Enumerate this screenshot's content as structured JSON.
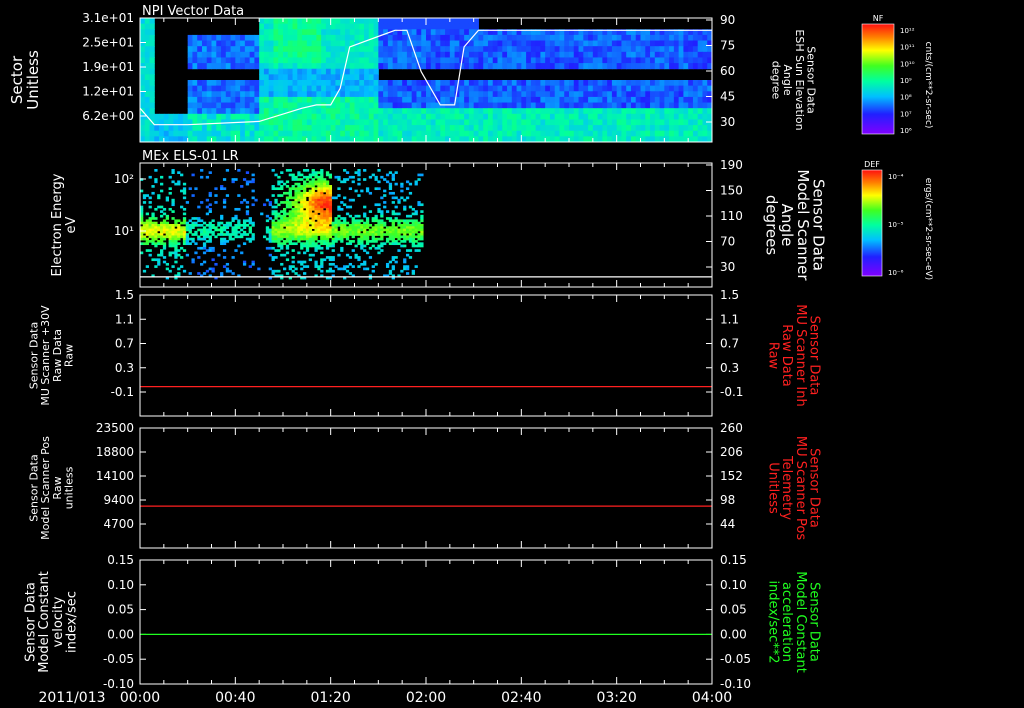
{
  "date_label": "2011/013",
  "x_axis": {
    "ticks": [
      "00:00",
      "00:40",
      "01:20",
      "02:00",
      "02:40",
      "03:20",
      "04:00"
    ],
    "range_minutes": [
      0,
      240
    ]
  },
  "colorbars": [
    {
      "tag": "NF",
      "unit": "cnts/(cm**2-sr-sec)",
      "ticks": [
        "10¹²",
        "10¹¹",
        "10¹⁰",
        "10⁹",
        "10⁸",
        "10⁷",
        "10⁶"
      ]
    },
    {
      "tag": "DEF",
      "unit": "ergs/(cm**2-sr-sec-eV)",
      "ticks": [
        "10⁻⁴",
        "10⁻⁵",
        "10⁻⁶"
      ]
    }
  ],
  "chart_data": [
    {
      "type": "heatmap",
      "title": "NPI Vector Data",
      "ylabel": [
        "Sector",
        "Unitless"
      ],
      "y_ticks": [
        "3.1e+01",
        "2.5e+01",
        "1.9e+01",
        "1.2e+01",
        "6.2e+00"
      ],
      "right_label": [
        "Sensor Data",
        "ESH Sun Elevation",
        "Angle",
        "degree"
      ],
      "right_ticks": [
        "90",
        "75",
        "60",
        "45",
        "30"
      ],
      "y2lim": [
        20,
        90
      ],
      "line": {
        "name": "ESH Sun Elevation",
        "color": "#ffffff",
        "x": [
          0,
          6,
          20,
          50,
          68,
          74,
          80,
          84,
          88,
          107,
          112,
          118,
          126,
          132,
          136,
          142,
          240
        ],
        "y": [
          38,
          28,
          28,
          30,
          38,
          40,
          40,
          50,
          75,
          85,
          85,
          60,
          40,
          40,
          75,
          85,
          85
        ]
      }
    },
    {
      "type": "heatmap",
      "title": "MEx ELS-01 LR",
      "ylabel": [
        "Electron Energy",
        "eV"
      ],
      "y_ticks": [
        "10²",
        "10¹"
      ],
      "ylim_log": [
        0.3,
        2.25
      ],
      "right_label": [
        "Sensor Data",
        "Model Scanner",
        "Angle",
        "degrees"
      ],
      "right_ticks": [
        "190",
        "150",
        "110",
        "70",
        "30"
      ],
      "y2lim": [
        0,
        190
      ],
      "data_extent_minutes": [
        0,
        118
      ],
      "line": {
        "name": "Model Scanner Angle",
        "color": "#ffffff",
        "x": [
          0,
          240
        ],
        "y": [
          10,
          10
        ]
      }
    },
    {
      "type": "line",
      "ylabel": [
        "Sensor Data",
        "MU Scanner +30V",
        "Raw Data",
        "Raw"
      ],
      "y_ticks": [
        "1.5",
        "1.1",
        "0.7",
        "0.3",
        "-0.1"
      ],
      "ylim": [
        -0.35,
        1.5
      ],
      "right_label": [
        "Sensor Data",
        "MU Scanner Inh",
        "Raw Data",
        "Raw"
      ],
      "right_ticks": [
        "1.5",
        "1.1",
        "0.7",
        "0.3",
        "-0.1"
      ],
      "series": [
        {
          "name": "MU Scanner Inh",
          "color": "#ff2020",
          "x": [
            0,
            240
          ],
          "y": [
            0.1,
            0.1
          ]
        }
      ]
    },
    {
      "type": "line",
      "ylabel": [
        "Sensor Data",
        "Model Scanner Pos",
        "Raw",
        "unitless"
      ],
      "y_ticks": [
        "23500",
        "18800",
        "14100",
        "9400",
        "4700"
      ],
      "ylim": [
        0,
        23500
      ],
      "right_label": [
        "Sensor Data",
        "MU Scanner Pos",
        "Telemetry",
        "Unitless"
      ],
      "right_ticks": [
        "260",
        "206",
        "152",
        "98",
        "44"
      ],
      "series": [
        {
          "name": "MU Scanner Pos",
          "color": "#ff2020",
          "x": [
            0,
            240
          ],
          "y": [
            8200,
            8200
          ]
        }
      ]
    },
    {
      "type": "line",
      "ylabel": [
        "Sensor Data",
        "Model Constant",
        "velocity",
        "index/sec"
      ],
      "y_ticks": [
        "0.15",
        "0.10",
        "0.05",
        "0.00",
        "-0.05",
        "-0.10"
      ],
      "ylim": [
        -0.1,
        0.15
      ],
      "right_label": [
        "Sensor Data",
        "Model Constant",
        "acceleration",
        "index/sec**2"
      ],
      "right_ticks": [
        "0.15",
        "0.10",
        "0.05",
        "0.00",
        "-0.05",
        "-0.10"
      ],
      "series": [
        {
          "name": "Model Constant acceleration",
          "color": "#20ff20",
          "x": [
            0,
            240
          ],
          "y": [
            0.0,
            0.0
          ]
        }
      ]
    }
  ]
}
